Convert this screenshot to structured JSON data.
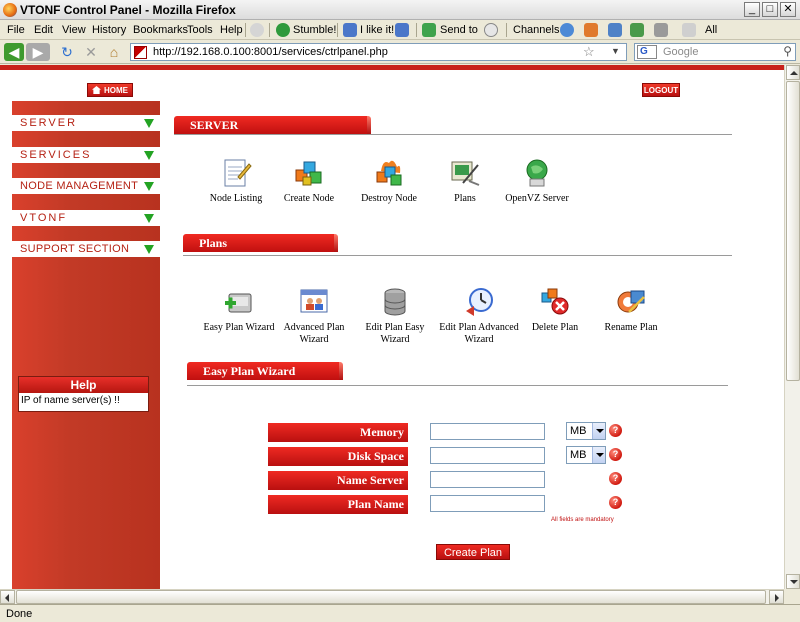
{
  "window": {
    "title": "VTONF Control Panel - Mozilla Firefox",
    "btn_min": "_",
    "btn_max": "□",
    "btn_close": "✕"
  },
  "menubar": {
    "items": [
      "File",
      "Edit",
      "View",
      "History",
      "Bookmarks",
      "Tools",
      "Help"
    ],
    "stumble": "Stumble!",
    "ilike": "I like it!",
    "sendto": "Send to",
    "channels": "Channels:",
    "all": "All"
  },
  "navbar": {
    "url": "http://192.168.0.100:8001/services/ctrlpanel.php",
    "search_placeholder": "Google",
    "back_glyph": "◀",
    "forward_glyph": "▶",
    "reload_glyph": "↻",
    "stop_glyph": "✕",
    "home_glyph": "⌂",
    "star_glyph": "☆",
    "dropdown_glyph": "▼",
    "search_glyph": "⚲",
    "search_engine_letter": "G"
  },
  "page": {
    "home_label": "HOME",
    "logout_label": "LOGOUT",
    "sidebar": [
      {
        "label": "SERVER",
        "narrow": false
      },
      {
        "label": "SERVICES",
        "narrow": false
      },
      {
        "label": "NODE MANAGEMENT",
        "narrow": true
      },
      {
        "label": "VTONF",
        "narrow": false
      },
      {
        "label": "SUPPORT SECTION",
        "narrow": true
      }
    ],
    "help": {
      "title": "Help",
      "text": "IP of name server(s) !!"
    },
    "server_section": {
      "title": "SERVER",
      "items": [
        {
          "label": "Node Listing",
          "icon": "notepad-icon"
        },
        {
          "label": "Create Node",
          "icon": "cubes-icon"
        },
        {
          "label": "Destroy Node",
          "icon": "fire-cubes-icon"
        },
        {
          "label": "Plans",
          "icon": "plans-icon"
        },
        {
          "label": "OpenVZ Server",
          "icon": "globe-server-icon"
        }
      ]
    },
    "plans_section": {
      "title": "Plans",
      "items": [
        {
          "label": "Easy Plan Wizard",
          "icon": "drive-add-icon"
        },
        {
          "label": "Advanced Plan Wizard",
          "icon": "users-window-icon"
        },
        {
          "label": "Edit Plan Easy Wizard",
          "icon": "database-icon"
        },
        {
          "label": "Edit Plan Advanced Wizard",
          "icon": "clock-icon"
        },
        {
          "label": "Delete Plan",
          "icon": "delete-icon"
        },
        {
          "label": "Rename Plan",
          "icon": "rename-icon"
        }
      ]
    },
    "wizard": {
      "title": "Easy Plan Wizard",
      "fields": [
        {
          "label": "Memory",
          "value": "",
          "unit": "MB"
        },
        {
          "label": "Disk Space",
          "value": "",
          "unit": "MB"
        },
        {
          "label": "Name Server",
          "value": "",
          "unit": ""
        },
        {
          "label": "Plan Name",
          "value": "",
          "unit": ""
        }
      ],
      "help_glyph": "?",
      "mandatory_note": "All fields are mandatory",
      "submit_label": "Create Plan"
    }
  },
  "status": {
    "text": "Done"
  },
  "colors": {
    "brand_red": "#c8221a",
    "arrow_green": "#23a323"
  }
}
